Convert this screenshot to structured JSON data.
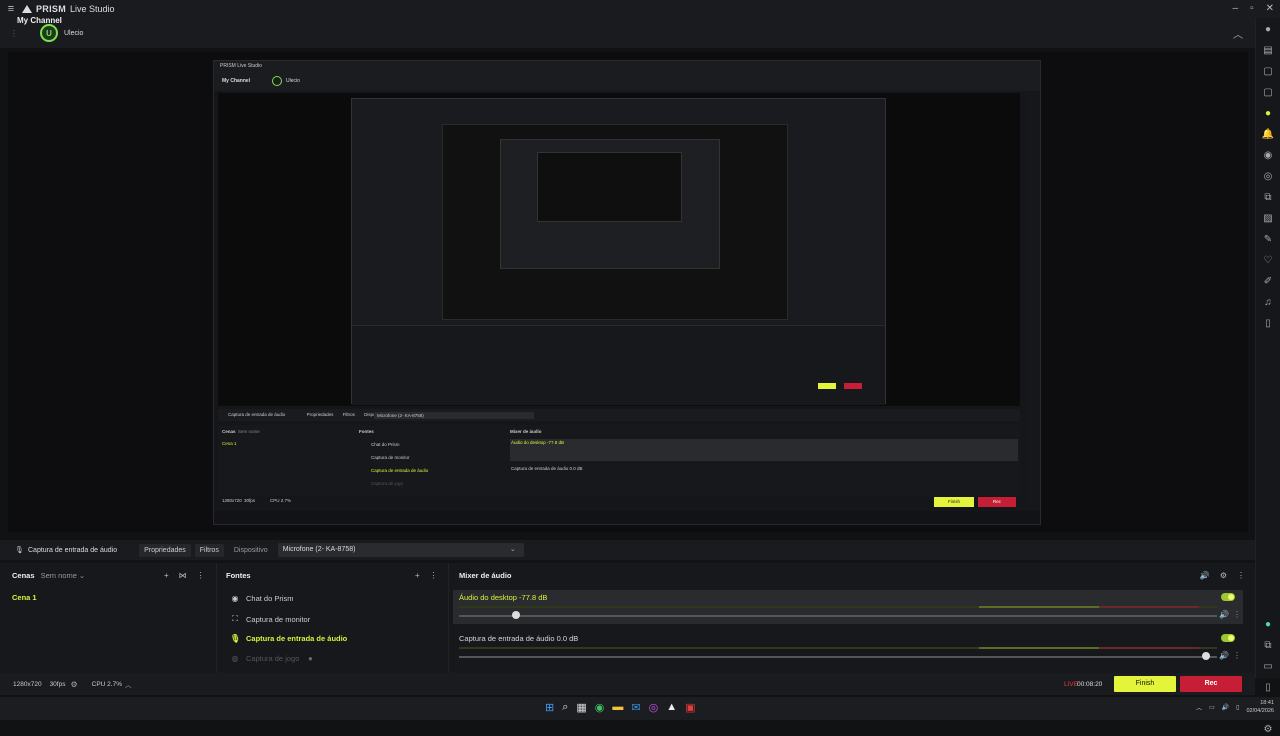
{
  "app": {
    "brand": "PRISM",
    "title": "Live Studio"
  },
  "channel": {
    "name": "My Channel",
    "username": "Ulecio",
    "avatar_letter": "U"
  },
  "inner": {
    "brand": "PRISM Live Studio",
    "channel": "My Channel",
    "username": "Ulecio",
    "source": "Captura de entrada de áudio",
    "tab_properties": "Propriedades",
    "tab_filters": "Filtros",
    "device_label": "Dispositivo",
    "device_value": "Microfone (2- KA-8758)",
    "scenes_title": "Cenas",
    "scenes_sub": "Sem nome",
    "scene1": "Cena 1",
    "sources_title": "Fontes",
    "sources": [
      "Chat do Prism",
      "Captura de monitor",
      "Captura de entrada de áudio",
      "Captura de jogo"
    ],
    "mixer_title": "Mixer de áudio",
    "mix1": "Áudio do desktop  -77.8 dB",
    "mix2": "Captura de entrada de áudio  0.0 dB",
    "res": "1280x720",
    "fps": "30fps",
    "cpu": "CPU 2.7%",
    "finish": "Finish",
    "rec": "Rec"
  },
  "properties_bar": {
    "source_name": "Captura de entrada de áudio",
    "tab_properties": "Propriedades",
    "tab_filters": "Filtros",
    "device_label": "Dispositivo",
    "device_value": "Microfone (2- KA-8758)"
  },
  "scenes": {
    "title": "Cenas",
    "subtitle": "Sem nome",
    "items": [
      "Cena 1"
    ]
  },
  "sources": {
    "title": "Fontes",
    "items": [
      {
        "label": "Chat do Prism",
        "icon": "chat-icon"
      },
      {
        "label": "Captura de monitor",
        "icon": "monitor-icon"
      },
      {
        "label": "Captura de entrada de áudio",
        "icon": "microphone-icon"
      },
      {
        "label": "Captura de jogo",
        "icon": "gamepad-icon"
      }
    ]
  },
  "mixer": {
    "title": "Mixer de áudio",
    "channels": [
      {
        "label": "Áudio do desktop  -77.8 dB",
        "level": 0.07
      },
      {
        "label": "Captura de entrada de áudio  0.0 dB",
        "level": 0.99
      }
    ]
  },
  "status": {
    "resolution": "1280x720",
    "fps": "30fps",
    "cpu": "CPU 2.7%",
    "live": "LIVE",
    "timer": "00:08:20",
    "finish": "Finish",
    "rec": "Rec"
  },
  "taskbar": {
    "time": "18:41",
    "date": "02/04/2026"
  },
  "colors": {
    "accent": "#d9f23a",
    "rec": "#c61f35",
    "live": "#e43b3b",
    "bg": "#17181b"
  }
}
